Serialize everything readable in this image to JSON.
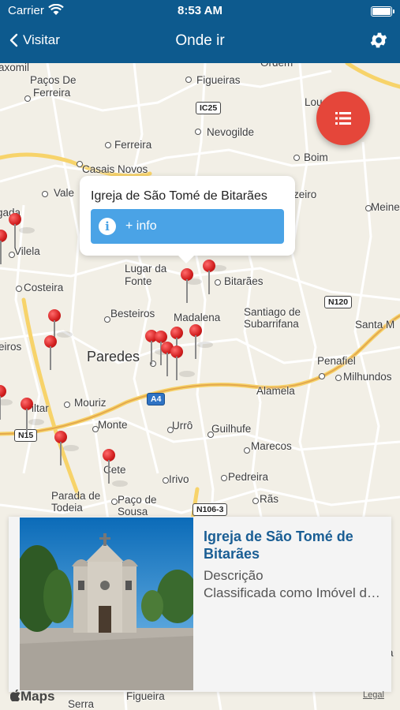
{
  "status": {
    "carrier": "Carrier",
    "time": "8:53 AM"
  },
  "nav": {
    "back_label": "Visitar",
    "title": "Onde ir"
  },
  "map": {
    "places": [
      "axomil",
      "Paços De",
      "Ferreira",
      "Figueiras",
      "Ordem",
      "Lou",
      "Nevogilde",
      "Ferreira",
      "Boim",
      "Casais Novos",
      "Vale",
      "zeiro",
      "Meine",
      "gada",
      "Vilela",
      "Lugar da",
      "Fonte",
      "Bitarães",
      "Costeira",
      "Santiago de",
      "Subarrifana",
      "Besteiros",
      "Madalena",
      "Santa M",
      "eiros",
      "Paredes",
      "Penafiel",
      "Milhundos",
      "Alamela",
      "iltar",
      "Mouriz",
      "Monte",
      "Urrô",
      "Guilhufe",
      "Marecos",
      "Cete",
      "Irivo",
      "Pedreira",
      "Parada de",
      "Todeia",
      "Paço de",
      "Sousa",
      "Rãs",
      "Serra",
      "Figueira",
      "Sa"
    ],
    "roads": [
      "IC25",
      "N120",
      "A4",
      "N15",
      "N106-3"
    ]
  },
  "callout": {
    "title": "Igreja de São Tomé de Bitarães",
    "button_label": "+ info"
  },
  "card": {
    "title": "Igreja de São Tomé de Bitarães",
    "description_label": "Descrição",
    "description_text": "Classificada como Imóvel de Interesse Público"
  },
  "footer": {
    "maps_label": "Maps",
    "legal_label": "Legal"
  },
  "colors": {
    "nav_bg": "#0d5a8e",
    "fab": "#e5463a",
    "info_button": "#4aa3e6",
    "card_title": "#1a5e94"
  }
}
